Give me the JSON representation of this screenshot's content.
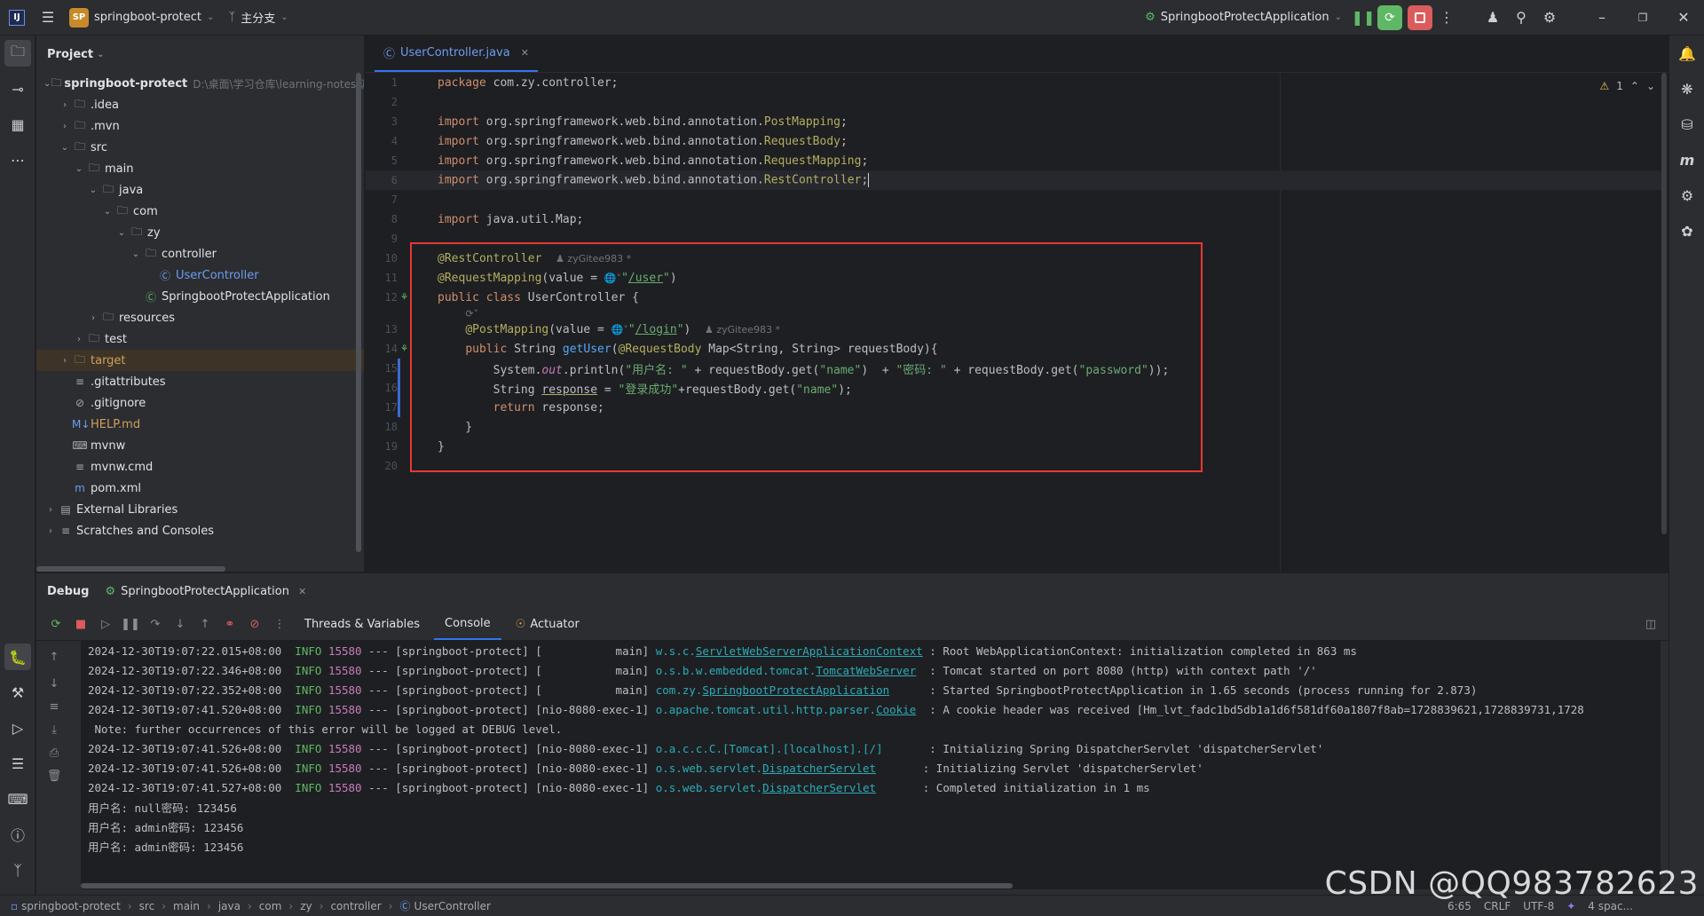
{
  "titlebar": {
    "project_badge": "SP",
    "project_name": "springboot-protect",
    "branch": "主分支",
    "run_config": "SpringbootProtectApplication"
  },
  "project_panel": {
    "title": "Project",
    "tree": [
      {
        "label": "springboot-protect",
        "hint": "D:\\桌面\\学习仓库\\learning-notes\\源",
        "icon": "folder",
        "depth": 0,
        "arrow": "down",
        "bold": true
      },
      {
        "label": ".idea",
        "icon": "folder",
        "depth": 1,
        "arrow": "right"
      },
      {
        "label": ".mvn",
        "icon": "folder",
        "depth": 1,
        "arrow": "right"
      },
      {
        "label": "src",
        "icon": "folder",
        "depth": 1,
        "arrow": "down"
      },
      {
        "label": "main",
        "icon": "folder",
        "depth": 2,
        "arrow": "down"
      },
      {
        "label": "java",
        "icon": "folder",
        "depth": 3,
        "arrow": "down"
      },
      {
        "label": "com",
        "icon": "package",
        "depth": 4,
        "arrow": "down"
      },
      {
        "label": "zy",
        "icon": "package",
        "depth": 5,
        "arrow": "down"
      },
      {
        "label": "controller",
        "icon": "package",
        "depth": 6,
        "arrow": "down"
      },
      {
        "label": "UserController",
        "icon": "class",
        "depth": 7,
        "arrow": "",
        "color": "blue"
      },
      {
        "label": "SpringbootProtectApplication",
        "icon": "spring-class",
        "depth": 6,
        "arrow": ""
      },
      {
        "label": "resources",
        "icon": "folder",
        "depth": 3,
        "arrow": "right"
      },
      {
        "label": "test",
        "icon": "folder",
        "depth": 2,
        "arrow": "right"
      },
      {
        "label": "target",
        "icon": "folder",
        "depth": 1,
        "arrow": "right",
        "color": "orange",
        "selected": true
      },
      {
        "label": ".gitattributes",
        "icon": "text",
        "depth": 1,
        "arrow": ""
      },
      {
        "label": ".gitignore",
        "icon": "ignore",
        "depth": 1,
        "arrow": ""
      },
      {
        "label": "HELP.md",
        "icon": "markdown",
        "depth": 1,
        "arrow": "",
        "color": "orange"
      },
      {
        "label": "mvnw",
        "icon": "shell",
        "depth": 1,
        "arrow": ""
      },
      {
        "label": "mvnw.cmd",
        "icon": "text",
        "depth": 1,
        "arrow": ""
      },
      {
        "label": "pom.xml",
        "icon": "maven",
        "depth": 1,
        "arrow": ""
      },
      {
        "label": "External Libraries",
        "icon": "library",
        "depth": 0,
        "arrow": "right"
      },
      {
        "label": "Scratches and Consoles",
        "icon": "scratch",
        "depth": 0,
        "arrow": "right"
      }
    ]
  },
  "editor": {
    "tab": "UserController.java",
    "warnings": "1",
    "inlay_author": "zyGitee983 *",
    "lines": [
      {
        "n": "1",
        "html": "<span class='kw'>package</span> com.zy.controller;"
      },
      {
        "n": "2",
        "html": ""
      },
      {
        "n": "3",
        "html": "<span class='kw'>import</span> org.springframework.web.bind.annotation.<span class='ann'>PostMapping</span>;"
      },
      {
        "n": "4",
        "html": "<span class='kw'>import</span> org.springframework.web.bind.annotation.<span class='ann'>RequestBody</span>;"
      },
      {
        "n": "5",
        "html": "<span class='kw'>import</span> org.springframework.web.bind.annotation.<span class='ann'>RequestMapping</span>;"
      },
      {
        "n": "6",
        "html": "<span class='kw'>import</span> org.springframework.web.bind.annotation.<span class='ann'>RestController</span>;<span class='caret'></span>"
      },
      {
        "n": "7",
        "html": ""
      },
      {
        "n": "8",
        "html": "<span class='kw'>import</span> java.util.Map;"
      },
      {
        "n": "9",
        "html": ""
      },
      {
        "n": "10",
        "html": "<span class='ann'>@RestController</span>  <span class='inlay'>&#9823; zyGitee983 *</span>"
      },
      {
        "n": "11",
        "html": "<span class='ann'>@RequestMapping</span>(value = <span class='inlay'>&#127760;&#709;</span><span class='str'>\"<u>/user</u>\"</span>)"
      },
      {
        "n": "12",
        "html": "<span class='kw'>public class</span> UserController {",
        "gutter": "bean"
      },
      {
        "n": "",
        "html": "    <span class='inlay'>&#10227;&#709;</span>",
        "small": true
      },
      {
        "n": "13",
        "html": "    <span class='ann'>@PostMapping</span>(value = <span class='inlay'>&#127760;&#709;</span><span class='str'>\"<u>/login</u>\"</span>)  <span class='inlay'>&#9823; zyGitee983 *</span>"
      },
      {
        "n": "14",
        "html": "    <span class='kw'>public</span> String <span class='fn'>getUser</span>(<span class='ann'>@RequestBody</span> Map&lt;String, String&gt; requestBody){",
        "gutter": "bean"
      },
      {
        "n": "15",
        "html": "        System.<span class='fld'>out</span>.println(<span class='str'>\"用户名: \"</span> + requestBody.get(<span class='str'>\"name\"</span>)  + <span class='str'>\"密码: \"</span> + requestBody.get(<span class='str'>\"password\"</span>));"
      },
      {
        "n": "16",
        "html": "        String <u style='text-decoration-color:#b3ae60'>response</u> = <span class='str'>\"登录成功\"</span>+requestBody.get(<span class='str'>\"name\"</span>);"
      },
      {
        "n": "17",
        "html": "        <span class='kw'>return</span> response;"
      },
      {
        "n": "18",
        "html": "    }"
      },
      {
        "n": "19",
        "html": "}"
      },
      {
        "n": "20",
        "html": ""
      }
    ]
  },
  "debug": {
    "title": "Debug",
    "session_tab": "SpringbootProtectApplication",
    "subtabs": [
      "Threads & Variables",
      "Console",
      "Actuator"
    ],
    "log": [
      {
        "ts": "2024-12-30T19:07:22.015+08:00",
        "level": "INFO",
        "pid": "15580",
        "thread": "--- [springboot-protect] [           main]",
        "cls_pre": "w.s.c.",
        "cls_link": "ServletWebServerApplicationContext",
        "pad": " ",
        "msg": ": Root WebApplicationContext: initialization completed in 863 ms"
      },
      {
        "ts": "2024-12-30T19:07:22.346+08:00",
        "level": "INFO",
        "pid": "15580",
        "thread": "--- [springboot-protect] [           main]",
        "cls_pre": "o.s.b.w.embedded.tomcat.",
        "cls_link": "TomcatWebServer",
        "pad": "  ",
        "msg": ": Tomcat started on port 8080 (http) with context path '/'"
      },
      {
        "ts": "2024-12-30T19:07:22.352+08:00",
        "level": "INFO",
        "pid": "15580",
        "thread": "--- [springboot-protect] [           main]",
        "cls_pre": "com.zy.",
        "cls_link": "SpringbootProtectApplication",
        "pad": "      ",
        "msg": ": Started SpringbootProtectApplication in 1.65 seconds (process running for 2.873)"
      },
      {
        "ts": "2024-12-30T19:07:41.520+08:00",
        "level": "INFO",
        "pid": "15580",
        "thread": "--- [springboot-protect] [nio-8080-exec-1]",
        "cls_pre": "o.apache.tomcat.util.http.parser.",
        "cls_link": "Cookie",
        "pad": "  ",
        "msg": ": A cookie header was received [Hm_lvt_fadc1bd5db1a1d6f581df60a1807f8ab=1728839621,1728839731,1728"
      },
      {
        "plain": " Note: further occurrences of this error will be logged at DEBUG level."
      },
      {
        "ts": "2024-12-30T19:07:41.526+08:00",
        "level": "INFO",
        "pid": "15580",
        "thread": "--- [springboot-protect] [nio-8080-exec-1]",
        "cls_pre": "o.a.c.c.C.[Tomcat].[localhost].[/]",
        "cls_link": "",
        "pad": "       ",
        "msg": ": Initializing Spring DispatcherServlet 'dispatcherServlet'"
      },
      {
        "ts": "2024-12-30T19:07:41.526+08:00",
        "level": "INFO",
        "pid": "15580",
        "thread": "--- [springboot-protect] [nio-8080-exec-1]",
        "cls_pre": "o.s.web.servlet.",
        "cls_link": "DispatcherServlet",
        "pad": "       ",
        "msg": ": Initializing Servlet 'dispatcherServlet'"
      },
      {
        "ts": "2024-12-30T19:07:41.527+08:00",
        "level": "INFO",
        "pid": "15580",
        "thread": "--- [springboot-protect] [nio-8080-exec-1]",
        "cls_pre": "o.s.web.servlet.",
        "cls_link": "DispatcherServlet",
        "pad": "       ",
        "msg": ": Completed initialization in 1 ms"
      },
      {
        "plain": "用户名: null密码: 123456"
      },
      {
        "plain": "用户名: admin密码: 123456"
      },
      {
        "plain": "用户名: admin密码: 123456"
      }
    ]
  },
  "statusbar": {
    "breadcrumbs": [
      "springboot-protect",
      "src",
      "main",
      "java",
      "com",
      "zy",
      "controller",
      "UserController"
    ],
    "position": "6:65",
    "line_sep": "CRLF",
    "encoding": "UTF-8",
    "indent": "4 spac..."
  },
  "watermark": "CSDN @QQ983782623"
}
